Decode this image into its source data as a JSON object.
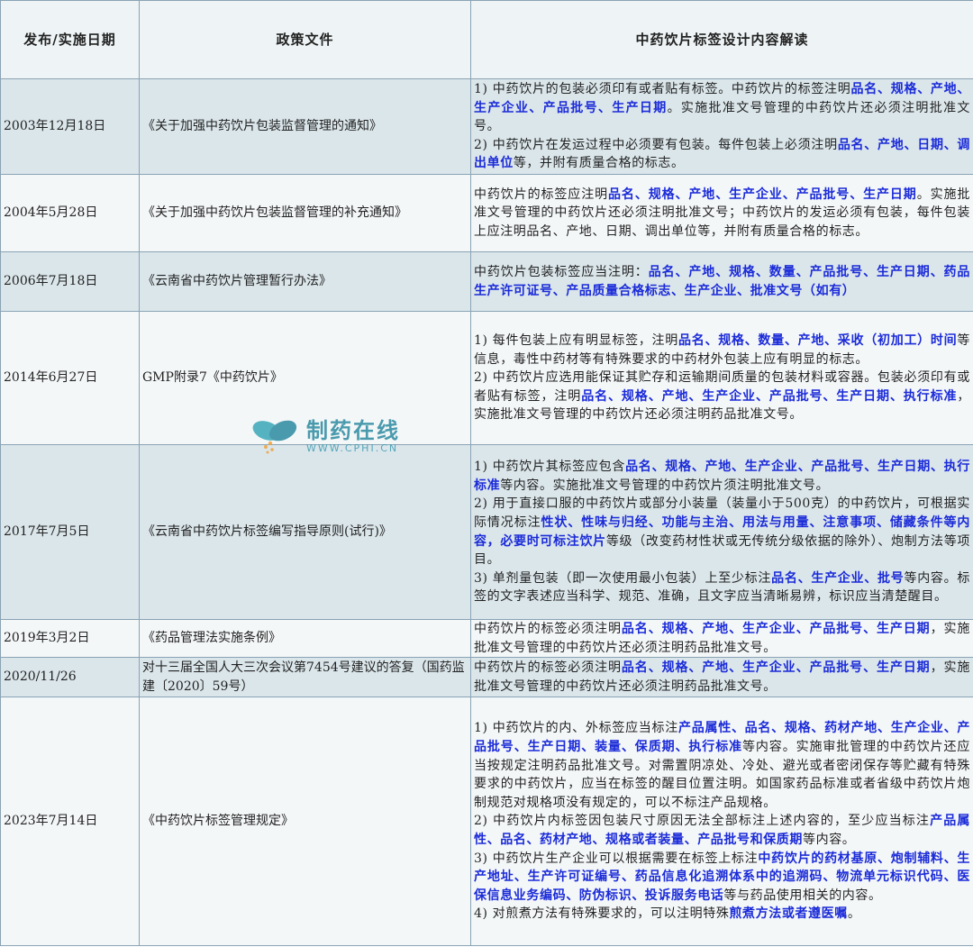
{
  "header": {
    "col_date": "发布/实施日期",
    "col_doc": "政策文件",
    "col_content": "中药饮片标签设计内容解读"
  },
  "watermark": {
    "name": "制药在线",
    "url": "WWW.CPHI.CN",
    "logo_colors": [
      "#3aa8b8",
      "#2d8aa0",
      "#f0a23a"
    ]
  },
  "colors": {
    "highlight": "#1b2bd8",
    "row_shaded": "#dbe6eb",
    "row_plain": "#f4f7f8",
    "border": "#8aa3b4"
  },
  "rows": [
    {
      "date": "2003年12月18日",
      "doc": "《关于加强中药饮片包装监督管理的通知》",
      "items": [
        [
          {
            "t": "1) 中药饮片的包装必须印有或者贴有标签。中药饮片的标签注明"
          },
          {
            "t": "品名、规格、产地、生产企业、产品批号、生产日期",
            "b": true
          },
          {
            "t": "。实施批准文号管理的中药饮片还必须注明批准文号。"
          }
        ],
        [
          {
            "t": "2) 中药饮片在发运过程中必须要有包装。每件包装上必须注明"
          },
          {
            "t": "品名、产地、日期、调出单位",
            "b": true
          },
          {
            "t": "等，并附有质量合格的标志。"
          }
        ]
      ]
    },
    {
      "date": "2004年5月28日",
      "doc": "《关于加强中药饮片包装监督管理的补充通知》",
      "items": [
        [
          {
            "t": "中药饮片的标签应注明"
          },
          {
            "t": "品名、规格、产地、生产企业、产品批号、生产日期",
            "b": true
          },
          {
            "t": "。实施批准文号管理的中药饮片还必须注明批准文号；中药饮片的发运必须有包装，每件包装上应注明品名、产地、日期、调出单位等，并附有质量合格的标志。"
          }
        ]
      ]
    },
    {
      "date": "2006年7月18日",
      "doc": "《云南省中药饮片管理暂行办法》",
      "items": [
        [
          {
            "t": "中药饮片包装标签应当注明："
          },
          {
            "t": "品名、产地、规格、数量、产品批号、生产日期、药品生产许可证号、产品质量合格标志、生产企业、批准文号（如有）",
            "b": true
          }
        ]
      ]
    },
    {
      "date": "2014年6月27日",
      "doc": "GMP附录7《中药饮片》",
      "items": [
        [
          {
            "t": "1) 每件包装上应有明显标签，注明"
          },
          {
            "t": "品名、规格、数量、产地、采收（初加工）时间",
            "b": true
          },
          {
            "t": "等信息，毒性中药材等有特殊要求的中药材外包装上应有明显的标志。"
          }
        ],
        [
          {
            "t": "2) 中药饮片应选用能保证其贮存和运输期间质量的包装材料或容器。包装必须印有或者贴有标签，注明"
          },
          {
            "t": "品名、规格、产地、生产企业、产品批号、生产日期、执行标准",
            "b": true
          },
          {
            "t": "，实施批准文号管理的中药饮片还必须注明药品批准文号。"
          }
        ]
      ]
    },
    {
      "date": "2017年7月5日",
      "doc": "《云南省中药饮片标签编写指导原则(试行)》",
      "items": [
        [
          {
            "t": "1) 中药饮片其标签应包含"
          },
          {
            "t": "品名、规格、产地、生产企业、产品批号、生产日期、执行标准",
            "b": true
          },
          {
            "t": "等内容。实施批准文号管理的中药饮片须注明批准文号。"
          }
        ],
        [
          {
            "t": "2) 用于直接口服的中药饮片或部分小装量（装量小于500克）的中药饮片，可根据实际情况标注"
          },
          {
            "t": "性状、性味与归经、功能与主治、用法与用量、注意事项、储藏条件等内容，必要时可标注饮片",
            "b": true
          },
          {
            "t": "等级（改变药材性状或无传统分级依据的除外）、炮制方法等项目。"
          }
        ],
        [
          {
            "t": "3) 单剂量包装（即一次使用最小包装）上至少标注"
          },
          {
            "t": "品名、生产企业、批号",
            "b": true
          },
          {
            "t": "等内容。标签的文字表述应当科学、规范、准确，且文字应当清晰易辨，标识应当清楚醒目。"
          }
        ]
      ]
    },
    {
      "date": "2019年3月2日",
      "doc": "《药品管理法实施条例》",
      "items": [
        [
          {
            "t": "中药饮片的标签必须注明"
          },
          {
            "t": "品名、规格、产地、生产企业、产品批号、生产日期",
            "b": true
          },
          {
            "t": "，实施批准文号管理的中药饮片还必须注明药品批准文号。"
          }
        ]
      ]
    },
    {
      "date": "2020/11/26",
      "doc": "对十三届全国人大三次会议第7454号建议的答复（国药监建〔2020〕59号）",
      "items": [
        [
          {
            "t": "中药饮片的标签必须注明"
          },
          {
            "t": "品名、规格、产地、生产企业、产品批号、生产日期",
            "b": true
          },
          {
            "t": "，实施批准文号管理的中药饮片还必须注明药品批准文号。"
          }
        ]
      ]
    },
    {
      "date": "2023年7月14日",
      "doc": "《中药饮片标签管理规定》",
      "items": [
        [
          {
            "t": "1) 中药饮片的内、外标签应当标注"
          },
          {
            "t": "产品属性、品名、规格、药材产地、生产企业、产品批号、生产日期、装量、保质期、执行标准",
            "b": true
          },
          {
            "t": "等内容。实施审批管理的中药饮片还应当按规定注明药品批准文号。对需置阴凉处、冷处、避光或者密闭保存等贮藏有特殊要求的中药饮片，应当在标签的醒目位置注明。如国家药品标准或者省级中药饮片炮制规范对规格项没有规定的，可以不标注产品规格。"
          }
        ],
        [
          {
            "t": "2) 中药饮片内标签因包装尺寸原因无法全部标注上述内容的，至少应当标注"
          },
          {
            "t": "产品属性、品名、药材产地、规格或者装量、产品批号和保质期",
            "b": true
          },
          {
            "t": "等内容。"
          }
        ],
        [
          {
            "t": "3) 中药饮片生产企业可以根据需要在标签上标注"
          },
          {
            "t": "中药饮片的药材基原、炮制辅料、生产地址、生产许可证编号、药品信息化追溯体系中的追溯码、物流单元标识代码、医保信息业务编码、防伪标识、投诉服务电话",
            "b": true
          },
          {
            "t": "等与药品使用相关的内容。"
          }
        ],
        [
          {
            "t": "4) 对煎煮方法有特殊要求的，可以注明特殊"
          },
          {
            "t": "煎煮方法或者遵医嘱",
            "b": true
          },
          {
            "t": "。"
          }
        ]
      ]
    }
  ]
}
